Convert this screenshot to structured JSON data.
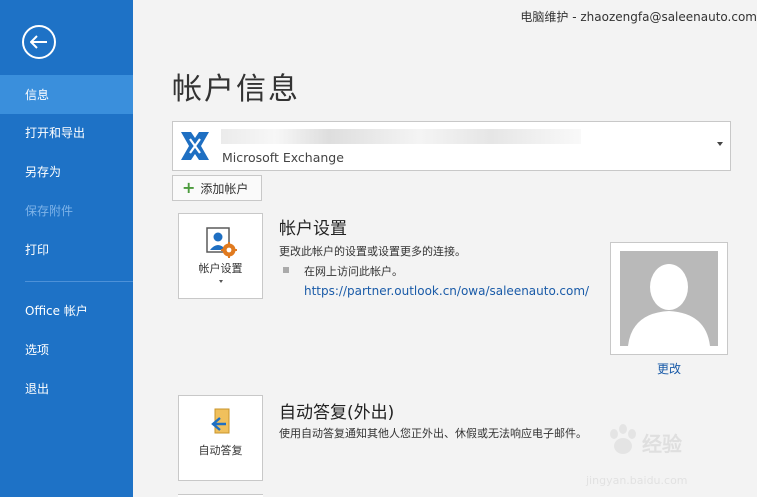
{
  "header": {
    "user_name": "电脑维护",
    "separator": " - ",
    "user_email": "zhaozengfa@saleenauto.com"
  },
  "sidebar": {
    "items": [
      {
        "label": "信息",
        "active": true
      },
      {
        "label": "打开和导出"
      },
      {
        "label": "另存为"
      },
      {
        "label": "保存附件",
        "disabled": true
      },
      {
        "label": "打印"
      },
      {
        "label": "Office 帐户"
      },
      {
        "label": "选项"
      },
      {
        "label": "退出"
      }
    ]
  },
  "main": {
    "title": "帐户信息",
    "account": {
      "type": "Microsoft Exchange"
    },
    "add_account_label": "添加帐户",
    "account_settings": {
      "tile_label": "帐户设置",
      "title": "帐户设置",
      "description": "更改此帐户的设置或设置更多的连接。",
      "bullet_text": "在网上访问此帐户。",
      "link": "https://partner.outlook.cn/owa/saleenauto.com/"
    },
    "profile": {
      "change_label": "更改"
    },
    "auto_reply": {
      "tile_label": "自动答复",
      "title": "自动答复(外出)",
      "description": "使用自动答复通知其他人您正外出、休假或无法响应电子邮件。"
    }
  },
  "watermark": {
    "text": "经验",
    "url": "jingyan.baidu.com"
  },
  "colors": {
    "sidebar": "#1e72c6",
    "sidebar_active": "#3a8fdc",
    "link": "#1a5ba8",
    "background": "#f3f3f3"
  }
}
